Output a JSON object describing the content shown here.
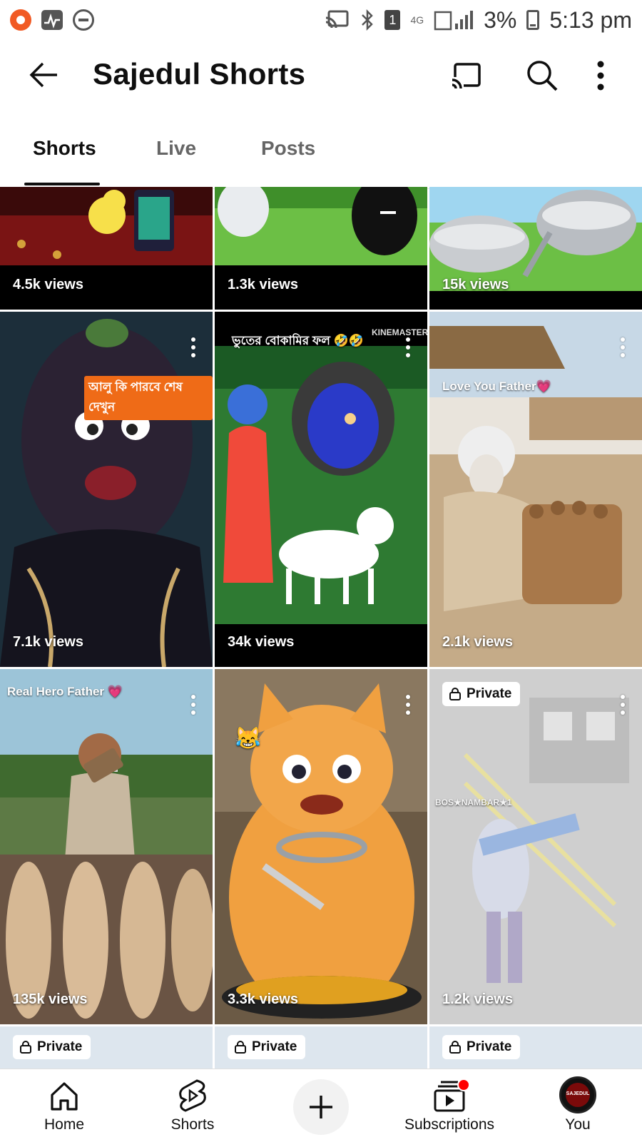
{
  "status_bar": {
    "network": "4G",
    "battery": "3%",
    "time": "5:13 pm",
    "sim": "1"
  },
  "header": {
    "title": "Sajedul Shorts",
    "icons": [
      "back-arrow-icon",
      "cast-icon",
      "search-icon",
      "more-vert-icon"
    ]
  },
  "tabs": [
    {
      "label": "Shorts",
      "active": true
    },
    {
      "label": "Live",
      "active": false
    },
    {
      "label": "Posts",
      "active": false
    }
  ],
  "grid": {
    "row1": [
      {
        "views": "4.5k views"
      },
      {
        "views": "1.3k views"
      },
      {
        "views": "15k views"
      }
    ],
    "row2": [
      {
        "views": "7.1k views",
        "caption": "আলু কি পারবে শেষ দেখুন"
      },
      {
        "views": "34k views",
        "caption": "ভুতের বোকামির ফল 🤣🤣",
        "watermark": "KINEMASTER"
      },
      {
        "views": "2.1k views",
        "caption": "Love You Father💗"
      }
    ],
    "row3": [
      {
        "views": "135k views",
        "caption": "Real Hero Father 💗"
      },
      {
        "views": "3.3k views",
        "caption": "😹"
      },
      {
        "views": "1.2k views",
        "private": "Private",
        "caption": "BOS★NAMBAR★1"
      }
    ],
    "row4": [
      {
        "private": "Private"
      },
      {
        "private": "Private"
      },
      {
        "private": "Private"
      }
    ]
  },
  "bottom_nav": [
    {
      "label": "Home",
      "icon": "home-icon"
    },
    {
      "label": "Shorts",
      "icon": "shorts-icon"
    },
    {
      "label": "",
      "icon": "create-plus-icon"
    },
    {
      "label": "Subscriptions",
      "icon": "subscriptions-icon"
    },
    {
      "label": "You",
      "icon": "avatar-icon",
      "avatar_text": "SAJEDUL"
    }
  ],
  "colors": {
    "accent_red": "#ff0000",
    "orange_tag": "#ef6b17",
    "text": "#0f0f0f"
  }
}
